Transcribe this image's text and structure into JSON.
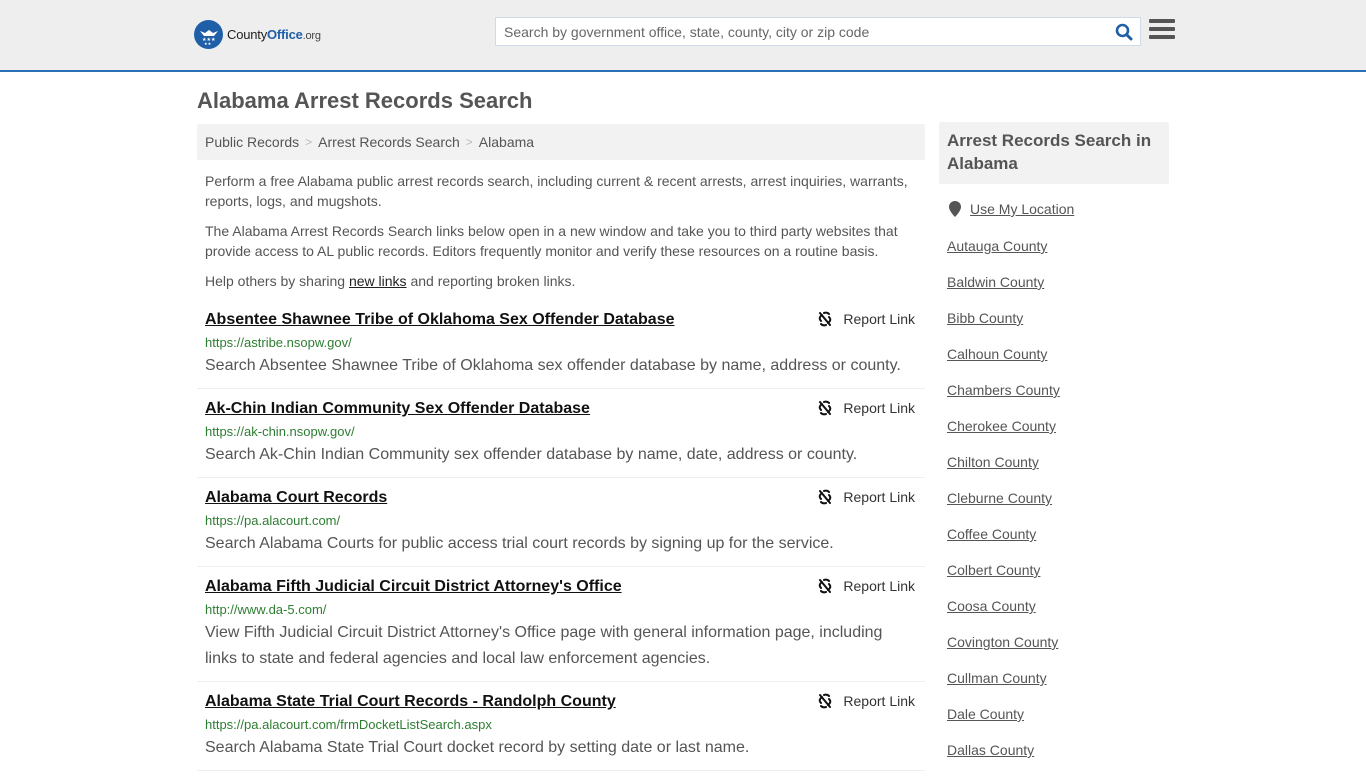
{
  "header": {
    "logo": {
      "county": "County",
      "office": "Office",
      "org": ".org"
    },
    "search": {
      "placeholder": "Search by government office, state, county, city or zip code",
      "value": ""
    },
    "accent_color": "#2a72b5"
  },
  "page": {
    "title": "Alabama Arrest Records Search",
    "breadcrumb": [
      "Public Records",
      "Arrest Records Search",
      "Alabama"
    ],
    "intro": {
      "p1": "Perform a free Alabama public arrest records search, including current & recent arrests, arrest inquiries, warrants, reports, logs, and mugshots.",
      "p2": "The Alabama Arrest Records Search links below open in a new window and take you to third party websites that provide access to AL public records. Editors frequently monitor and verify these resources on a routine basis.",
      "p3_before": "Help others by sharing ",
      "p3_link": "new links",
      "p3_after": " and reporting broken links."
    },
    "report_label": "Report Link",
    "results": [
      {
        "title": "Absentee Shawnee Tribe of Oklahoma Sex Offender Database",
        "url": "https://astribe.nsopw.gov/",
        "desc": "Search Absentee Shawnee Tribe of Oklahoma sex offender database by name, address or county."
      },
      {
        "title": "Ak-Chin Indian Community Sex Offender Database",
        "url": "https://ak-chin.nsopw.gov/",
        "desc": "Search Ak-Chin Indian Community sex offender database by name, date, address or county."
      },
      {
        "title": "Alabama Court Records",
        "url": "https://pa.alacourt.com/",
        "desc": "Search Alabama Courts for public access trial court records by signing up for the service."
      },
      {
        "title": "Alabama Fifth Judicial Circuit District Attorney's Office",
        "url": "http://www.da-5.com/",
        "desc": "View Fifth Judicial Circuit District Attorney's Office page with general information page, including links to state and federal agencies and local law enforcement agencies."
      },
      {
        "title": "Alabama State Trial Court Records - Randolph County",
        "url": "https://pa.alacourt.com/frmDocketListSearch.aspx",
        "desc": "Search Alabama State Trial Court docket record by setting date or last name."
      }
    ]
  },
  "sidebar": {
    "title": "Arrest Records Search in Alabama",
    "use_location": "Use My Location",
    "counties": [
      "Autauga County",
      "Baldwin County",
      "Bibb County",
      "Calhoun County",
      "Chambers County",
      "Cherokee County",
      "Chilton County",
      "Cleburne County",
      "Coffee County",
      "Colbert County",
      "Coosa County",
      "Covington County",
      "Cullman County",
      "Dale County",
      "Dallas County"
    ]
  }
}
